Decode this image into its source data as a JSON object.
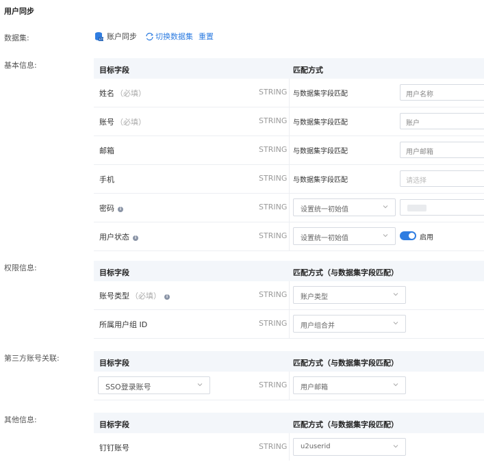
{
  "page_title": "用户同步",
  "dataset": {
    "label": "数据集:",
    "name": "账户同步",
    "switch_label": "切换数据集",
    "reset_label": "重置"
  },
  "basic": {
    "label": "基本信息:",
    "col_target": "目标字段",
    "col_match": "匹配方式",
    "rows": [
      {
        "name": "姓名",
        "req": "（必填）",
        "type": "STRING",
        "match": "与数据集字段匹配",
        "value": "用户名称"
      },
      {
        "name": "账号",
        "req": "（必填）",
        "type": "STRING",
        "match": "与数据集字段匹配",
        "value": "账户"
      },
      {
        "name": "邮箱",
        "type": "STRING",
        "match": "与数据集字段匹配",
        "value": "用户邮箱"
      },
      {
        "name": "手机",
        "type": "STRING",
        "match": "与数据集字段匹配",
        "placeholder": "请选择"
      },
      {
        "name": "密码",
        "type": "STRING",
        "select": "设置统一初始值"
      },
      {
        "name": "用户状态",
        "type": "STRING",
        "select": "设置统一初始值",
        "toggle_label": "启用"
      }
    ]
  },
  "perm": {
    "label": "权限信息:",
    "col_target": "目标字段",
    "col_match": "匹配方式（与数据集字段匹配）",
    "rows": [
      {
        "name": "账号类型",
        "req": "（必填）",
        "type": "STRING",
        "select": "账户类型"
      },
      {
        "name": "所属用户组 ID",
        "type": "STRING",
        "select": "用户组合并"
      }
    ]
  },
  "third": {
    "label": "第三方账号关联:",
    "col_target": "目标字段",
    "col_match": "匹配方式（与数据集字段匹配）",
    "rows": [
      {
        "target_select": "SSO登录账号",
        "type": "STRING",
        "select": "用户邮箱"
      }
    ]
  },
  "other": {
    "label": "其他信息:",
    "col_target": "目标字段",
    "col_match": "匹配方式（与数据集字段匹配）",
    "rows": [
      {
        "name": "钉钉账号",
        "type": "STRING",
        "select": "u2userid"
      }
    ]
  },
  "colors": {
    "accent": "#2f7de1",
    "header_bg": "#f3f6fa"
  }
}
